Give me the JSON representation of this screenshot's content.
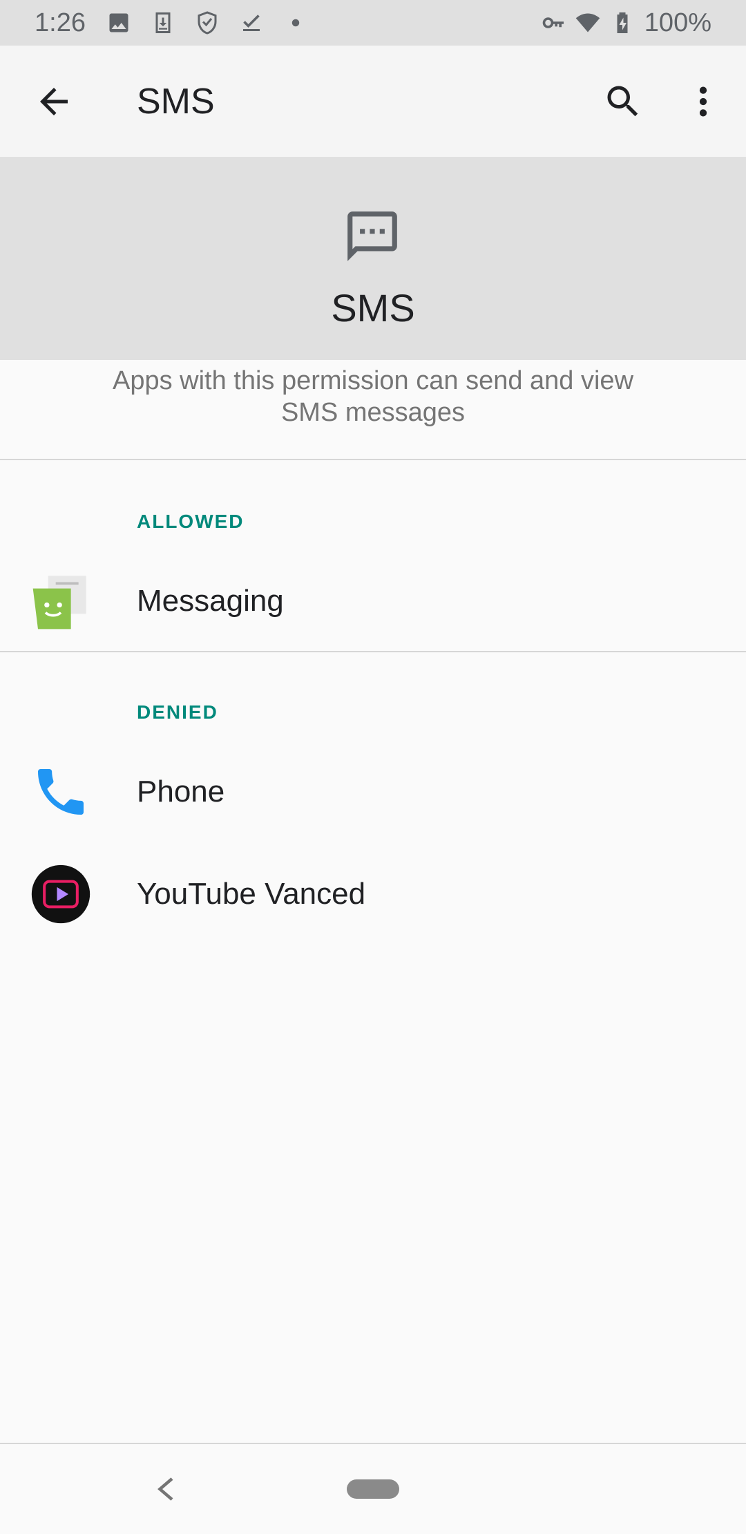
{
  "status_bar": {
    "time": "1:26",
    "battery": "100%",
    "left_icons": [
      "image-icon",
      "download-icon",
      "shield-icon",
      "checkmark-icon",
      "dot-icon"
    ],
    "right_icons": [
      "vpn-key-icon",
      "wifi-icon",
      "battery-charging-icon"
    ]
  },
  "app_bar": {
    "title": "SMS",
    "icons": [
      "back-arrow-icon",
      "search-icon",
      "more-vert-icon"
    ]
  },
  "header": {
    "icon": "sms-bubble-icon",
    "title": "SMS"
  },
  "description": "Apps with this permission can send and view SMS messages",
  "sections": {
    "allowed": {
      "label": "ALLOWED",
      "apps": [
        {
          "name": "Messaging",
          "icon": "messaging-app-icon"
        }
      ]
    },
    "denied": {
      "label": "DENIED",
      "apps": [
        {
          "name": "Phone",
          "icon": "phone-app-icon"
        },
        {
          "name": "YouTube Vanced",
          "icon": "youtube-vanced-app-icon"
        }
      ]
    }
  },
  "nav_bar": {
    "icons": [
      "nav-back-icon",
      "home-pill"
    ]
  },
  "colors": {
    "accent": "#00897b",
    "status_bar_bg": "#e0e0e0",
    "app_bar_bg": "#f5f5f5",
    "header_bg": "#e0e0e0",
    "background": "#fafafa"
  }
}
